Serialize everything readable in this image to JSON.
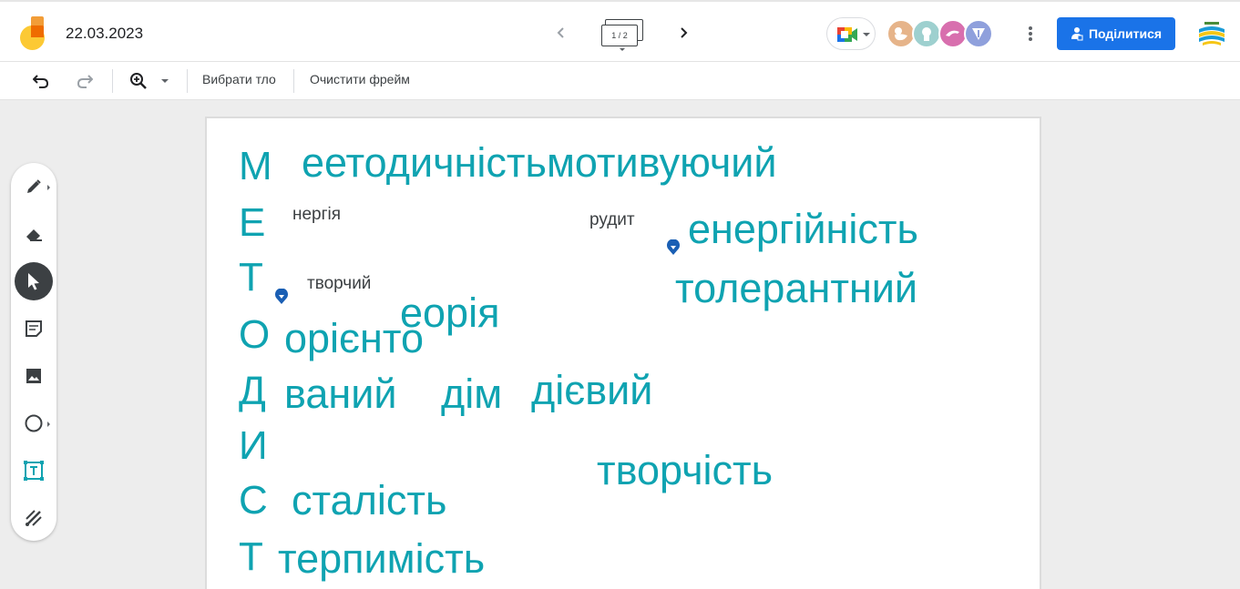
{
  "header": {
    "title": "22.03.2023",
    "frame_counter": "1 / 2",
    "share_label": "Поділитися"
  },
  "toolbar": {
    "background_label": "Вибрати тло",
    "clear_label": "Очистити фрейм"
  },
  "tools": [
    "pen",
    "eraser",
    "select",
    "sticky-note",
    "image",
    "shape",
    "text-box",
    "laser"
  ],
  "active_tool": "select",
  "canvas": {
    "letters": [
      "М",
      "Е",
      "Т",
      "О",
      "Д",
      "И",
      "С",
      "Т"
    ],
    "words_big": [
      "еетодичністьмотивуючий",
      "енергійність",
      "толерантний",
      "еорія",
      "орієнто",
      "ваний",
      "дім",
      "дієвий",
      "творчість",
      "сталість",
      "терпимість"
    ],
    "words_small": [
      "нергія",
      "рудит",
      "творчий"
    ]
  },
  "colors": {
    "accent": "#0fa3b1",
    "share_button": "#1a73e8",
    "active_tool": "#3c4043",
    "pin": "#1a5fb4"
  }
}
